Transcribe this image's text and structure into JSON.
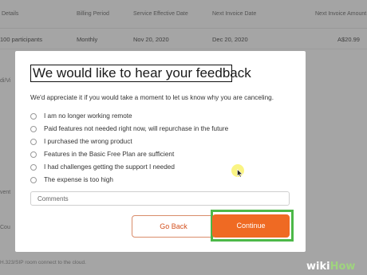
{
  "background": {
    "columns": [
      "Details",
      "Billing Period",
      "Service Effective Date",
      "Next Invoice Date",
      "Next Invoice Amount"
    ],
    "row": [
      "100 participants",
      "Monthly",
      "Nov 20, 2020",
      "Dec 20, 2020",
      "A$20.99"
    ],
    "side_labels": [
      "di/Vi",
      "vent",
      "Cou"
    ],
    "footer": "H.323/SIP room connect to the cloud."
  },
  "modal": {
    "title": "We would like to hear your feedback",
    "description": "We'd appreciate it if you would take a moment to let us know why you are canceling.",
    "options": [
      "I am no longer working remote",
      "Paid features not needed right now, will repurchase in the future",
      "I purchased the wrong product",
      "Features in the Basic Free Plan are sufficient",
      "I had challenges getting the support I needed",
      "The expense is too high"
    ],
    "comments_placeholder": "Comments",
    "go_back_label": "Go Back",
    "continue_label": "Continue"
  },
  "colors": {
    "accent": "#ef6a23",
    "highlight": "#4cb848"
  },
  "watermark": {
    "wiki": "wiki",
    "how": "How"
  }
}
